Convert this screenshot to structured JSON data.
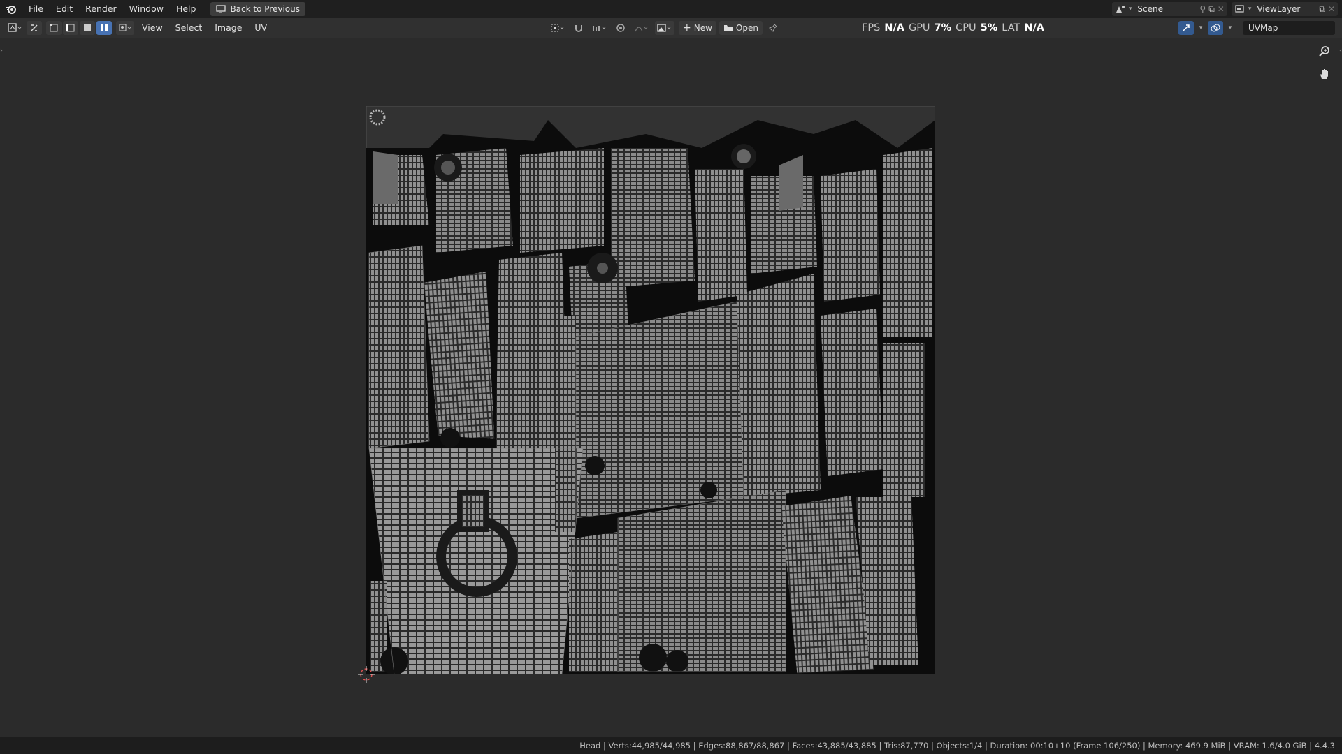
{
  "app_menu": [
    "File",
    "Edit",
    "Render",
    "Window",
    "Help"
  ],
  "back_button": "Back to Previous",
  "scene": {
    "name": "Scene",
    "view_layer": "ViewLayer"
  },
  "editor_menu": [
    "View",
    "Select",
    "Image",
    "UV"
  ],
  "image_tools": {
    "new_label": "New",
    "open_label": "Open"
  },
  "stats": {
    "fps_label": "FPS",
    "fps": "N/A",
    "gpu_label": "GPU",
    "gpu": "7%",
    "cpu_label": "CPU",
    "cpu": "5%",
    "lat_label": "LAT",
    "lat": "N/A"
  },
  "uv_map": "UVMap",
  "status_bar": "Head | Verts:44,985/44,985 | Edges:88,867/88,867 | Faces:43,885/43,885 | Tris:87,770 | Objects:1/4 | Duration: 00:10+10 (Frame 106/250) | Memory: 469.9 MiB | VRAM: 1.6/4.0 GiB | 4.4.3",
  "colors": {
    "accent": "#4772b3",
    "background": "#2b2b2b",
    "topbar": "#1f1f1f",
    "uv_island": "#8a8a8a"
  }
}
